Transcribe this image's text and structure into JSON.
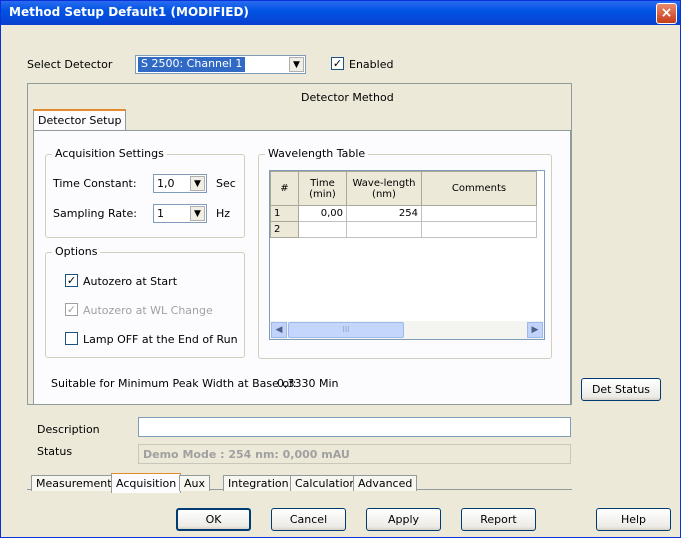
{
  "window": {
    "title": "Method Setup Default1 (MODIFIED)",
    "close_glyph": "×"
  },
  "detector": {
    "label": "Select Detector",
    "selected": "S 2500: Channel 1",
    "enabled_label": "Enabled",
    "enabled": true
  },
  "method_title": "Detector Method",
  "inner_tab": "Detector Setup",
  "acquisition": {
    "legend": "Acquisition Settings",
    "time_constant_label": "Time Constant:",
    "time_constant_value": "1,0",
    "time_constant_unit": "Sec",
    "sampling_rate_label": "Sampling Rate:",
    "sampling_rate_value": "1",
    "sampling_rate_unit": "Hz"
  },
  "options": {
    "legend": "Options",
    "autozero_start": {
      "label": "Autozero at Start",
      "checked": true
    },
    "autozero_wl": {
      "label": "Autozero at WL Change",
      "checked": true,
      "disabled": true
    },
    "lamp_off": {
      "label": "Lamp OFF at the End of Run",
      "checked": false
    }
  },
  "wavelength_table": {
    "legend": "Wavelength Table",
    "headers": [
      "#",
      "Time (min)",
      "Wave-length (nm)",
      "Comments"
    ],
    "rows": [
      {
        "num": "1",
        "time": "0,00",
        "wavelength": "254",
        "comments": ""
      },
      {
        "num": "2",
        "time": "",
        "wavelength": "",
        "comments": ""
      }
    ],
    "scroll_grip": "III"
  },
  "peak_width": {
    "label": "Suitable for Minimum Peak Width at Base of:",
    "value": "0,3330 Min"
  },
  "det_status_button": "Det Status",
  "description": {
    "label": "Description",
    "value": ""
  },
  "status": {
    "label": "Status",
    "value": "Demo Mode : 254 nm: 0,000 mAU"
  },
  "bottom_tabs": [
    "Measurement",
    "Acquisition",
    "Aux",
    "Integration",
    "Calculation",
    "Advanced"
  ],
  "active_bottom_tab": "Acquisition",
  "buttons": {
    "ok": "OK",
    "cancel": "Cancel",
    "apply": "Apply",
    "report": "Report",
    "help": "Help"
  },
  "checkmark_glyph": "✓"
}
